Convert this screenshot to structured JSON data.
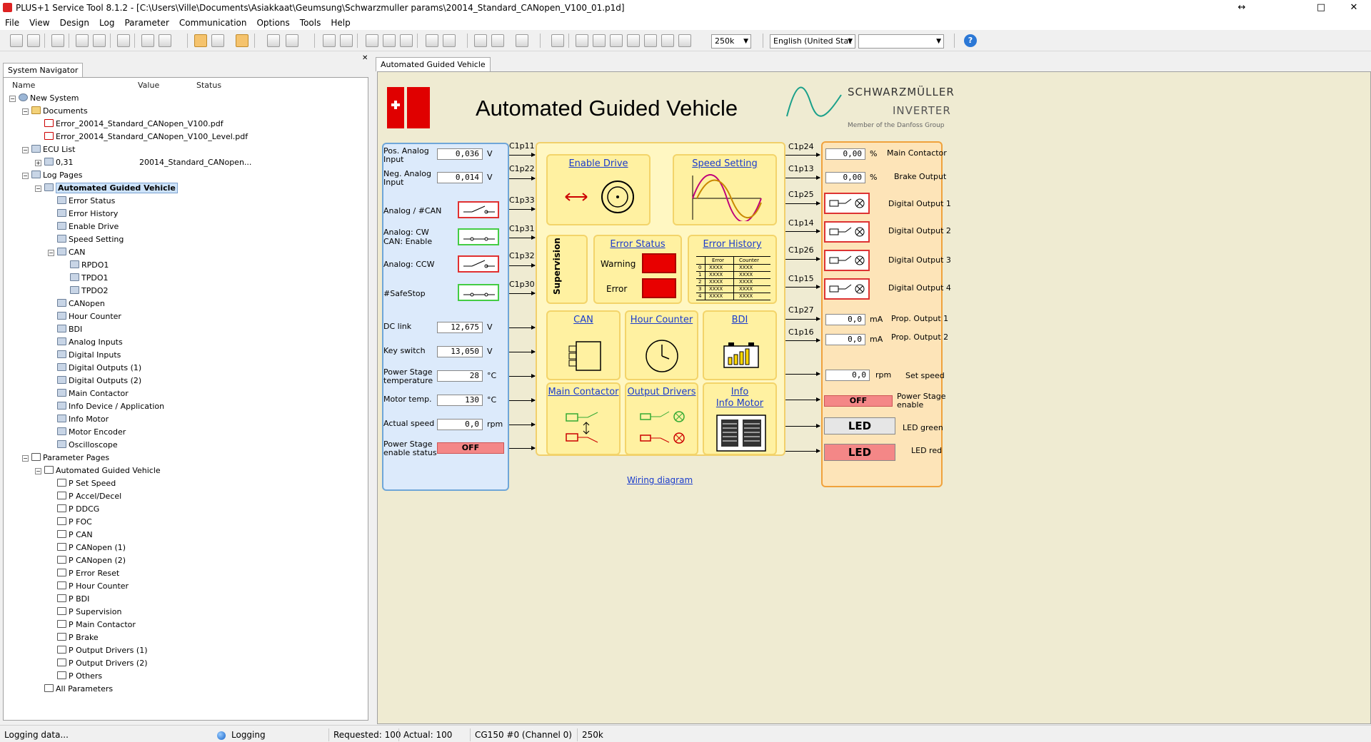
{
  "window": {
    "title": "PLUS+1 Service Tool 8.1.2 - [C:\\Users\\Ville\\Documents\\Asiakkaat\\Geumsung\\Schwarzmuller params\\20014_Standard_CANopen_V100_01.p1d]",
    "restore": "↔",
    "maximize": "□",
    "close": "✕"
  },
  "menu": [
    "File",
    "View",
    "Design",
    "Log",
    "Parameter",
    "Communication",
    "Options",
    "Tools",
    "Help"
  ],
  "toolbar": {
    "baud": "250k",
    "language": "English (United Stat",
    "extra": "",
    "help_icon": "help-icon"
  },
  "navigator": {
    "tab": "System Navigator",
    "columns": [
      "Name",
      "Value",
      "Status"
    ],
    "tree": [
      {
        "label": "New System",
        "indent": 0,
        "icon": "sys",
        "ex": "−"
      },
      {
        "label": "Documents",
        "indent": 1,
        "icon": "folder",
        "ex": "−"
      },
      {
        "label": "Error_20014_Standard_CANopen_V100.pdf",
        "indent": 2,
        "icon": "pdf"
      },
      {
        "label": "Error_20014_Standard_CANopen_V100_Level.pdf",
        "indent": 2,
        "icon": "pdf"
      },
      {
        "label": "ECU List",
        "indent": 1,
        "icon": "ecu",
        "ex": "−"
      },
      {
        "label": "0,31",
        "indent": 2,
        "icon": "ecu",
        "ex": "+",
        "value": "20014_Standard_CANopen..."
      },
      {
        "label": "Log Pages",
        "indent": 1,
        "icon": "ecu",
        "ex": "−"
      },
      {
        "label": "Automated Guided Vehicle",
        "indent": 2,
        "icon": "ecu",
        "ex": "−",
        "selected": true
      },
      {
        "label": "Error Status",
        "indent": 3,
        "icon": "ecu"
      },
      {
        "label": "Error History",
        "indent": 3,
        "icon": "ecu"
      },
      {
        "label": "Enable Drive",
        "indent": 3,
        "icon": "ecu"
      },
      {
        "label": "Speed Setting",
        "indent": 3,
        "icon": "ecu"
      },
      {
        "label": "CAN",
        "indent": 3,
        "icon": "ecu",
        "ex": "−"
      },
      {
        "label": "RPDO1",
        "indent": 4,
        "icon": "ecu"
      },
      {
        "label": "TPDO1",
        "indent": 4,
        "icon": "ecu"
      },
      {
        "label": "TPDO2",
        "indent": 4,
        "icon": "ecu"
      },
      {
        "label": "CANopen",
        "indent": 3,
        "icon": "ecu"
      },
      {
        "label": "Hour Counter",
        "indent": 3,
        "icon": "ecu"
      },
      {
        "label": "BDI",
        "indent": 3,
        "icon": "ecu"
      },
      {
        "label": "Analog Inputs",
        "indent": 3,
        "icon": "ecu"
      },
      {
        "label": "Digital Inputs",
        "indent": 3,
        "icon": "ecu"
      },
      {
        "label": "Digital Outputs (1)",
        "indent": 3,
        "icon": "ecu"
      },
      {
        "label": "Digital Outputs (2)",
        "indent": 3,
        "icon": "ecu"
      },
      {
        "label": "Main Contactor",
        "indent": 3,
        "icon": "ecu"
      },
      {
        "label": "Info Device / Application",
        "indent": 3,
        "icon": "ecu"
      },
      {
        "label": "Info Motor",
        "indent": 3,
        "icon": "ecu"
      },
      {
        "label": "Motor Encoder",
        "indent": 3,
        "icon": "ecu"
      },
      {
        "label": "Oscilloscope",
        "indent": 3,
        "icon": "ecu"
      },
      {
        "label": "Parameter Pages",
        "indent": 1,
        "icon": "param",
        "ex": "−"
      },
      {
        "label": "Automated Guided Vehicle",
        "indent": 2,
        "icon": "param",
        "ex": "−"
      },
      {
        "label": "P Set Speed",
        "indent": 3,
        "icon": "param"
      },
      {
        "label": "P Accel/Decel",
        "indent": 3,
        "icon": "param"
      },
      {
        "label": "P DDCG",
        "indent": 3,
        "icon": "param"
      },
      {
        "label": "P FOC",
        "indent": 3,
        "icon": "param"
      },
      {
        "label": "P CAN",
        "indent": 3,
        "icon": "param"
      },
      {
        "label": "P CANopen (1)",
        "indent": 3,
        "icon": "param"
      },
      {
        "label": "P CANopen (2)",
        "indent": 3,
        "icon": "param"
      },
      {
        "label": "P Error Reset",
        "indent": 3,
        "icon": "param"
      },
      {
        "label": "P Hour Counter",
        "indent": 3,
        "icon": "param"
      },
      {
        "label": "P BDI",
        "indent": 3,
        "icon": "param"
      },
      {
        "label": "P Supervision",
        "indent": 3,
        "icon": "param"
      },
      {
        "label": "P Main Contactor",
        "indent": 3,
        "icon": "param"
      },
      {
        "label": "P Brake",
        "indent": 3,
        "icon": "param"
      },
      {
        "label": "P Output Drivers (1)",
        "indent": 3,
        "icon": "param"
      },
      {
        "label": "P Output Drivers (2)",
        "indent": 3,
        "icon": "param"
      },
      {
        "label": "P Others",
        "indent": 3,
        "icon": "param"
      },
      {
        "label": "All Parameters",
        "indent": 2,
        "icon": "param"
      }
    ]
  },
  "main": {
    "tab": "Automated Guided Vehicle"
  },
  "hmi": {
    "title": "Automated Guided Vehicle",
    "brand": {
      "name": "SCHWARZMÜLLER",
      "sub": "INVERTER",
      "tag": "Member of the Danfoss Group"
    },
    "left": {
      "pos_analog": {
        "label1": "Pos. Analog",
        "label2": "Input",
        "value": "0,036",
        "unit": "V",
        "conn": "C1p11"
      },
      "neg_analog": {
        "label1": "Neg. Analog",
        "label2": "Input",
        "value": "0,014",
        "unit": "V",
        "conn": "C1p22"
      },
      "analog_can": {
        "label": "Analog / #CAN",
        "conn": "C1p33"
      },
      "analog_cw": {
        "label1": "Analog: CW",
        "label2": "CAN: Enable",
        "conn": "C1p31"
      },
      "analog_ccw": {
        "label": "Analog: CCW",
        "conn": "C1p32"
      },
      "safestop": {
        "label": "#SafeStop",
        "conn": "C1p30"
      },
      "dc_link": {
        "label": "DC link",
        "value": "12,675",
        "unit": "V"
      },
      "key_switch": {
        "label": "Key switch",
        "value": "13,050",
        "unit": "V"
      },
      "ps_temp": {
        "label1": "Power Stage",
        "label2": "temperature",
        "value": "28",
        "unit": "°C"
      },
      "motor_temp": {
        "label": "Motor temp.",
        "value": "130",
        "unit": "°C"
      },
      "actual_speed": {
        "label": "Actual speed",
        "value": "0,0",
        "unit": "rpm"
      },
      "ps_enable": {
        "label1": "Power Stage",
        "label2": "enable status",
        "value": "OFF"
      }
    },
    "center": {
      "enable_drive": "Enable Drive",
      "speed_setting": "Speed Setting",
      "supervision": "Supervision",
      "error_status": "Error Status",
      "warning": "Warning",
      "error": "Error",
      "error_history": "Error History",
      "eh_cols": [
        "Error",
        "Counter"
      ],
      "eh_rows": [
        "0",
        "1",
        "2",
        "3",
        "4"
      ],
      "eh_cell": "XXXX",
      "can": "CAN",
      "hour_counter": "Hour Counter",
      "bdi": "BDI",
      "main_contactor": "Main Contactor",
      "output_drivers": "Output Drivers",
      "info": "Info",
      "info_motor": "Info Motor",
      "wiring": "Wiring diagram"
    },
    "right": {
      "main_contactor": {
        "value": "0,00",
        "unit": "%",
        "label": "Main Contactor",
        "conn": "C1p24"
      },
      "brake": {
        "value": "0,00",
        "unit": "%",
        "label": "Brake Output",
        "conn": "C1p13"
      },
      "do1": {
        "label": "Digital Output 1",
        "conn": "C1p25"
      },
      "do2": {
        "label": "Digital Output 2",
        "conn": "C1p14"
      },
      "do3": {
        "label": "Digital Output 3",
        "conn": "C1p26"
      },
      "do4": {
        "label": "Digital Output 4",
        "conn": "C1p15"
      },
      "prop1": {
        "value": "0,0",
        "unit": "mA",
        "label": "Prop. Output 1",
        "conn": "C1p27"
      },
      "prop2": {
        "value": "0,0",
        "unit": "mA",
        "label": "Prop. Output 2",
        "conn": "C1p16"
      },
      "set_speed": {
        "value": "0,0",
        "unit": "rpm",
        "label": "Set speed"
      },
      "ps_enable": {
        "value": "OFF",
        "label1": "Power Stage",
        "label2": "enable"
      },
      "led_green": {
        "value": "LED",
        "label": "LED green"
      },
      "led_red": {
        "value": "LED",
        "label": "LED red"
      }
    }
  },
  "status": {
    "left": "Logging data...",
    "logging": "Logging",
    "requested": "Requested: 100",
    "actual": "Actual: 100",
    "channel": "CG150 #0 (Channel 0)",
    "baud": "250k"
  },
  "colors": {
    "accent": "#e80000",
    "panel_left": "#dceafb",
    "panel_center": "#fff7c2",
    "panel_right": "#fde4b8",
    "link": "#1a3ccc"
  }
}
